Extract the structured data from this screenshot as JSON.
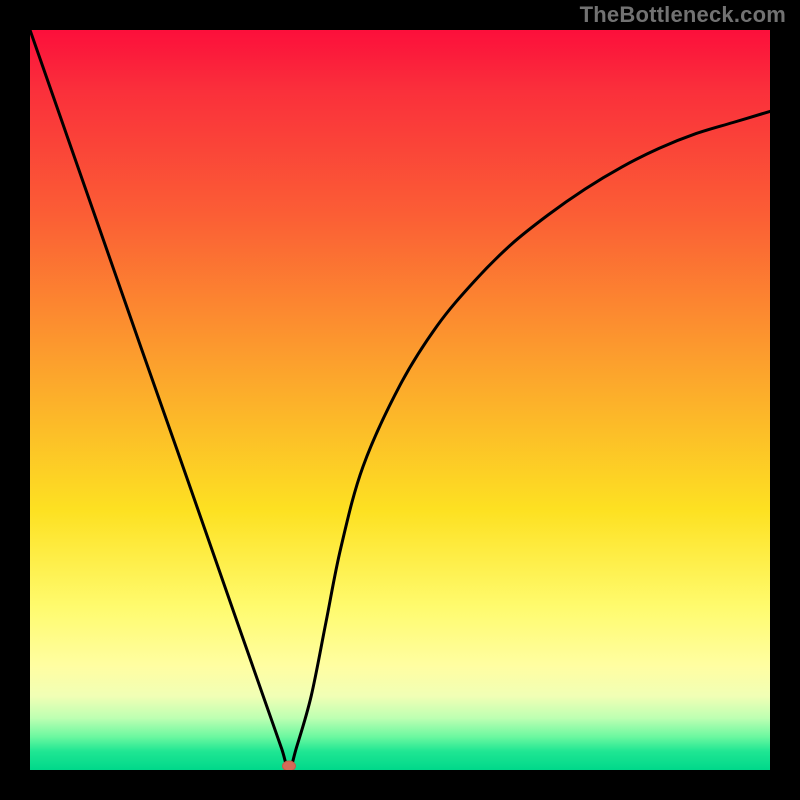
{
  "watermark": "TheBottleneck.com",
  "colors": {
    "frame_bg": "#000000",
    "watermark_text": "#727272",
    "curve_stroke": "#000000",
    "marker_fill": "#d56a58",
    "gradient_top": "#fc0f3b",
    "gradient_bottom": "#00d88a"
  },
  "chart_data": {
    "type": "line",
    "title": "",
    "xlabel": "",
    "ylabel": "",
    "xlim": [
      0,
      100
    ],
    "ylim": [
      0,
      100
    ],
    "annotations": [],
    "series": [
      {
        "name": "bottleneck-curve",
        "x": [
          0,
          5,
          10,
          15,
          20,
          25,
          28,
          30,
          32,
          34,
          35,
          36,
          38,
          40,
          42,
          45,
          50,
          55,
          60,
          65,
          70,
          75,
          80,
          85,
          90,
          95,
          100
        ],
        "y": [
          100,
          85.7,
          71.4,
          57.1,
          42.9,
          28.6,
          20.0,
          14.3,
          8.6,
          2.9,
          0,
          3,
          10,
          20,
          30,
          41,
          52,
          60,
          66,
          71,
          75,
          78.5,
          81.5,
          84,
          86,
          87.5,
          89
        ]
      }
    ],
    "min_point": {
      "x": 35,
      "y": 0
    },
    "background_gradient": {
      "direction": "top-to-bottom",
      "stops": [
        {
          "pos": 0.0,
          "color": "#fc0f3b"
        },
        {
          "pos": 0.25,
          "color": "#fb5e35"
        },
        {
          "pos": 0.45,
          "color": "#fca02d"
        },
        {
          "pos": 0.65,
          "color": "#fde122"
        },
        {
          "pos": 0.86,
          "color": "#fffea2"
        },
        {
          "pos": 1.0,
          "color": "#00d88a"
        }
      ]
    }
  }
}
